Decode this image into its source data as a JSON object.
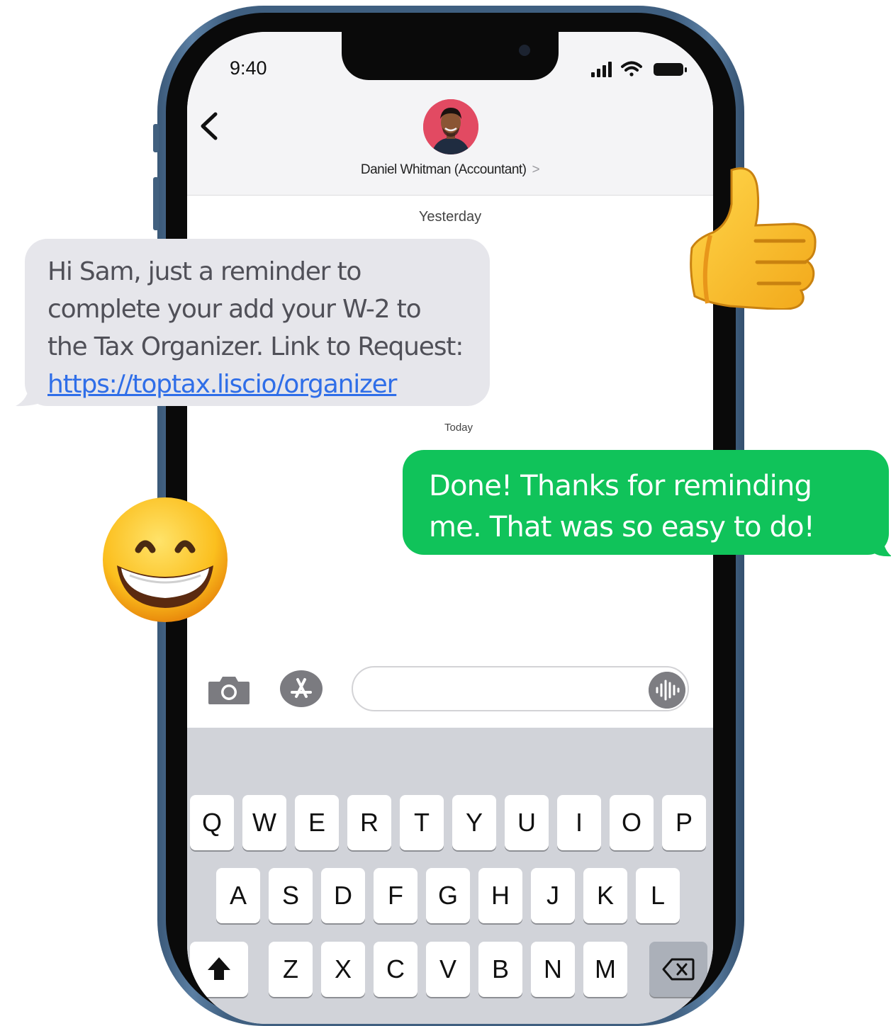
{
  "status_bar": {
    "time": "9:40"
  },
  "header": {
    "contact_name": "Daniel Whitman (Accountant)",
    "contact_chevron": ">"
  },
  "messages": {
    "date_yesterday": "Yesterday",
    "incoming": {
      "lines": [
        "Hi Sam, just a reminder to",
        "complete your add your W-2  to",
        "the Tax Organizer. Link to Request:"
      ],
      "link": "https://toptax.liscio/organizer"
    },
    "date_today": "Today",
    "outgoing": {
      "lines": [
        "Done! Thanks for reminding",
        "me. That was so easy to do!"
      ]
    }
  },
  "compose": {
    "placeholder": ""
  },
  "keyboard": {
    "row1": [
      "Q",
      "W",
      "E",
      "R",
      "T",
      "Y",
      "U",
      "I",
      "O",
      "P"
    ],
    "row2": [
      "A",
      "S",
      "D",
      "F",
      "G",
      "H",
      "J",
      "K",
      "L"
    ],
    "row3": [
      "Z",
      "X",
      "C",
      "V",
      "B",
      "N",
      "M"
    ]
  },
  "colors": {
    "incoming_bubble": "#e6e6eb",
    "outgoing_bubble": "#10c35a",
    "link": "#2f6ee8",
    "avatar_bg": "#e24a62"
  }
}
